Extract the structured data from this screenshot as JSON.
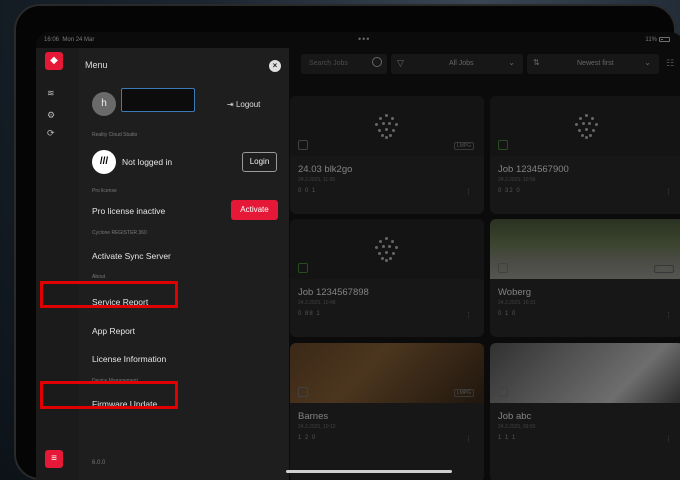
{
  "status_bar": {
    "time": "16:06",
    "date": "Mon 24 Mar",
    "dots": "•••",
    "battery": "11%"
  },
  "toolbar": {
    "search_placeholder": "Search Jobs",
    "filter_value": "All Jobs",
    "sort_value": "Newest first"
  },
  "jobs": [
    {
      "title": "24.03 blk2go",
      "date": "24.3.2025, 11:05",
      "meta": "0   0   1",
      "badge": "LMPG",
      "thumb": "logo"
    },
    {
      "title": "Job 1234567900",
      "date": "24.3.2025, 10:56",
      "meta": "0   32   0",
      "badge": "",
      "thumb": "logo"
    },
    {
      "title": "Job 1234567898",
      "date": "24.3.2025, 10:48",
      "meta": "0   88   1",
      "badge": "",
      "thumb": "logo"
    },
    {
      "title": "Woberg",
      "date": "24.3.2025, 10:31",
      "meta": "0   1   0",
      "badge": "LMPG",
      "thumb": "photo1"
    },
    {
      "title": "Barnes",
      "date": "24.3.2025, 10:12",
      "meta": "1   2   0",
      "badge": "LMPG",
      "thumb": "photo2"
    },
    {
      "title": "Job abc",
      "date": "24.3.2025, 09:55",
      "meta": "1   1   1",
      "badge": "",
      "thumb": "photo3"
    }
  ],
  "menu": {
    "title": "Menu",
    "avatar_initial": "h",
    "logout_label": "Logout",
    "section_rcs": "Reality Cloud Studio",
    "not_logged_in": "Not logged in",
    "login_label": "Login",
    "section_pro": "Pro license",
    "pro_inactive": "Pro license inactive",
    "activate_label": "Activate",
    "section_cyclone": "Cyclone REGISTER 360",
    "activate_sync": "Activate Sync Server",
    "section_about": "About",
    "service_report": "Service Report",
    "app_report": "App Report",
    "license_info": "License Information",
    "section_device": "Device Management",
    "firmware_update": "Firmware Update",
    "version": "6.0.0"
  },
  "colors": {
    "accent": "#e51937",
    "highlight": "#e00000"
  }
}
